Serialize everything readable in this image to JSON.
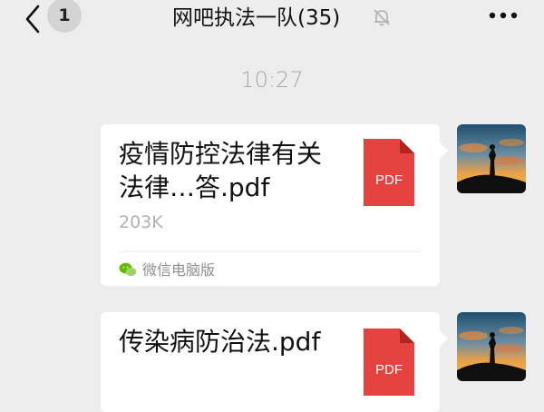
{
  "header": {
    "back_icon": "chevron-left-icon",
    "unread_count": "1",
    "title": "网吧执法一队(35)",
    "mute_icon": "bell-muted-icon",
    "more_icon": "more-horizontal-icon"
  },
  "timestamp": "10:27",
  "messages": [
    {
      "file_name": "疫情防控法律有关法律…答.pdf",
      "file_size": "203K",
      "file_icon_label": "PDF",
      "source": "微信电脑版",
      "source_icon": "wechat-icon"
    },
    {
      "file_name": "传染病防治法.pdf",
      "file_icon_label": "PDF"
    }
  ],
  "colors": {
    "background": "#ededed",
    "bubble": "#ffffff",
    "pdf_red": "#e64340",
    "secondary_text": "#b2b2b2"
  }
}
